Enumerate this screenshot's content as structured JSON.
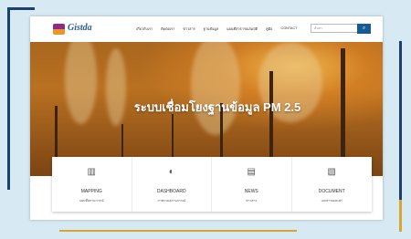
{
  "header": {
    "logo_text": "Gistda",
    "nav": [
      "เกี่ยวกับเรา",
      "ติดต่อเรา",
      "ข่าวสาร",
      "ฐานข้อมูล",
      "แผนที่สาธารณสมบัติ",
      "คู่มือ",
      "CONTACT"
    ],
    "search_placeholder": "ค้นหา",
    "search_icon": "search-icon"
  },
  "hero": {
    "title": "ระบบเชื่อมโยงฐานข้อมูล PM 2.5"
  },
  "cards": [
    {
      "icon": "map-icon",
      "title": "MAPPING",
      "subtitle": "แผนที่สถานการณ์"
    },
    {
      "icon": "dashboard-icon",
      "title": "DASHBOARD",
      "subtitle": "ภาพรวมสถานการณ์"
    },
    {
      "icon": "news-icon",
      "title": "NEWS",
      "subtitle": "ข่าวสาร"
    },
    {
      "icon": "document-icon",
      "title": "DOCUMENT",
      "subtitle": "เอกสารเผยแพร่"
    }
  ],
  "colors": {
    "page_bg": "#d7e9f3",
    "frame_blue": "#1d3f6e",
    "frame_gold": "#d7a531",
    "search_button": "#145b94",
    "hero_orange": "#c47b27"
  }
}
